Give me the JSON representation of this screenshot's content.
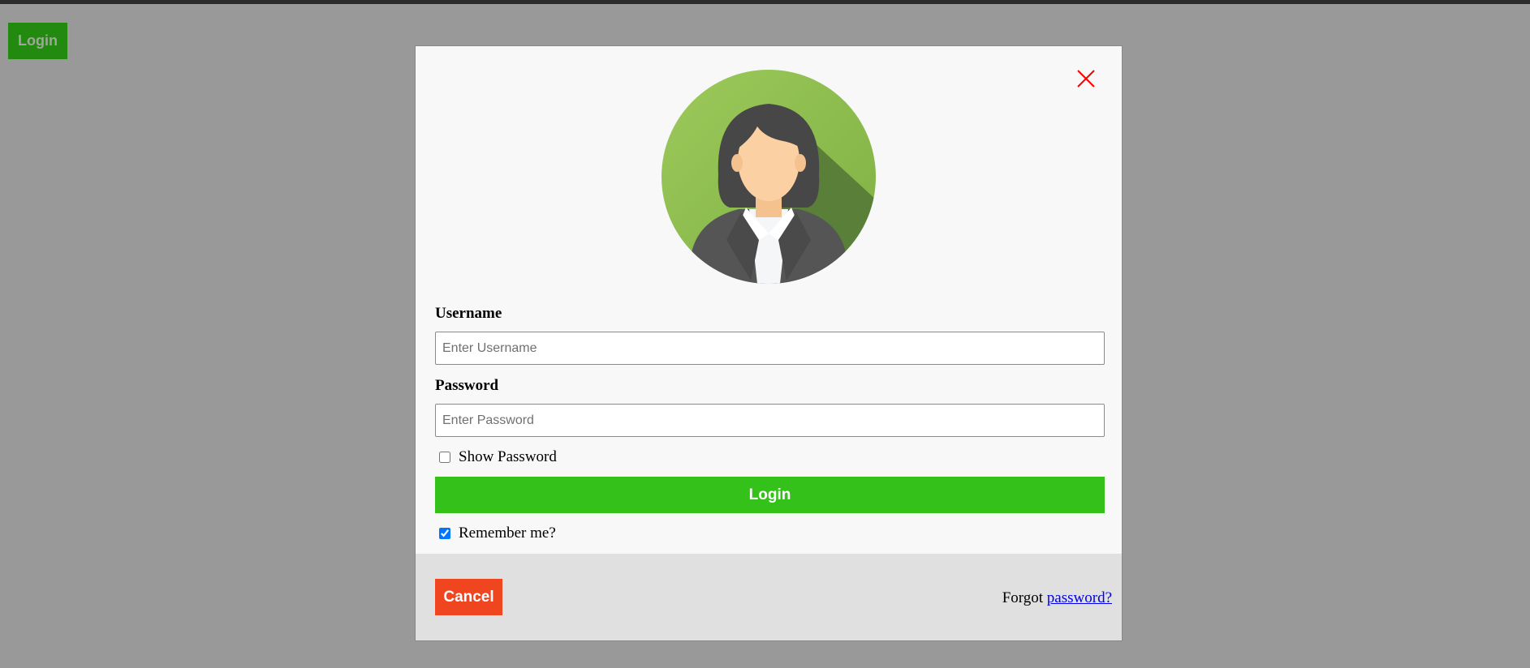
{
  "page": {
    "open_login_label": "Login"
  },
  "modal": {
    "close_icon": "close-icon",
    "avatar_icon": "female-user-avatar-icon",
    "username": {
      "label": "Username",
      "placeholder": "Enter Username",
      "value": ""
    },
    "password": {
      "label": "Password",
      "placeholder": "Enter Password",
      "value": ""
    },
    "show_password": {
      "label": "Show Password",
      "checked": false
    },
    "submit_label": "Login",
    "remember_me": {
      "label": "Remember me?",
      "checked": true
    }
  },
  "footer": {
    "cancel_label": "Cancel",
    "forgot_prefix": "Forgot",
    "forgot_link": "password?"
  },
  "colors": {
    "overlay": "#999999",
    "brand_green": "#34c119",
    "dark_green": "#238a10",
    "cancel_red": "#f0461f",
    "close_red": "#ff0000",
    "link_blue": "#0000ee"
  }
}
